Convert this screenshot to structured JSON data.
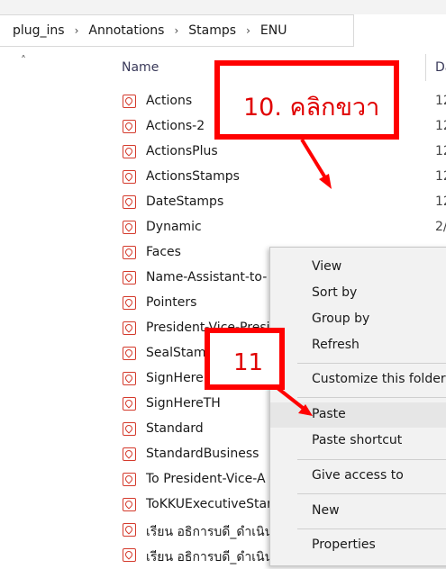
{
  "breadcrumb": [
    "plug_ins",
    "Annotations",
    "Stamps",
    "ENU"
  ],
  "breadcrumb_separator": "›",
  "columns": {
    "name": "Name",
    "date": "Da"
  },
  "files": [
    {
      "name": "Actions",
      "date": "12"
    },
    {
      "name": "Actions-2",
      "date": "12"
    },
    {
      "name": "ActionsPlus",
      "date": "12"
    },
    {
      "name": "ActionsStamps",
      "date": "12"
    },
    {
      "name": "DateStamps",
      "date": "12"
    },
    {
      "name": "Dynamic",
      "date": "2/"
    },
    {
      "name": "Faces",
      "date": ""
    },
    {
      "name": "Name-Assistant-to-",
      "date": ""
    },
    {
      "name": "Pointers",
      "date": ""
    },
    {
      "name": "President-Vice-Presi",
      "date": ""
    },
    {
      "name": "SealStamp",
      "date": ""
    },
    {
      "name": "SignHere",
      "date": ""
    },
    {
      "name": "SignHereTH",
      "date": ""
    },
    {
      "name": "Standard",
      "date": ""
    },
    {
      "name": "StandardBusiness",
      "date": ""
    },
    {
      "name": "To President-Vice-A",
      "date": ""
    },
    {
      "name": "ToKKUExecutiveStar",
      "date": ""
    },
    {
      "name": "เรียน อธิการบดี_ดำเนินก",
      "date": ""
    },
    {
      "name": "เรียน อธิการบดี_ดำเนินก",
      "date": ""
    }
  ],
  "context_menu": {
    "view": "View",
    "sort_by": "Sort by",
    "group_by": "Group by",
    "refresh": "Refresh",
    "customize": "Customize this folder",
    "paste": "Paste",
    "paste_shortcut": "Paste shortcut",
    "give_access": "Give access to",
    "new": "New",
    "properties": "Properties"
  },
  "annotations": {
    "step10": "10. คลิกขวา",
    "step11": "11",
    "color": "#ff0000"
  },
  "icons": {
    "file": "pdf-file-icon",
    "sort": "sort-up-icon"
  }
}
